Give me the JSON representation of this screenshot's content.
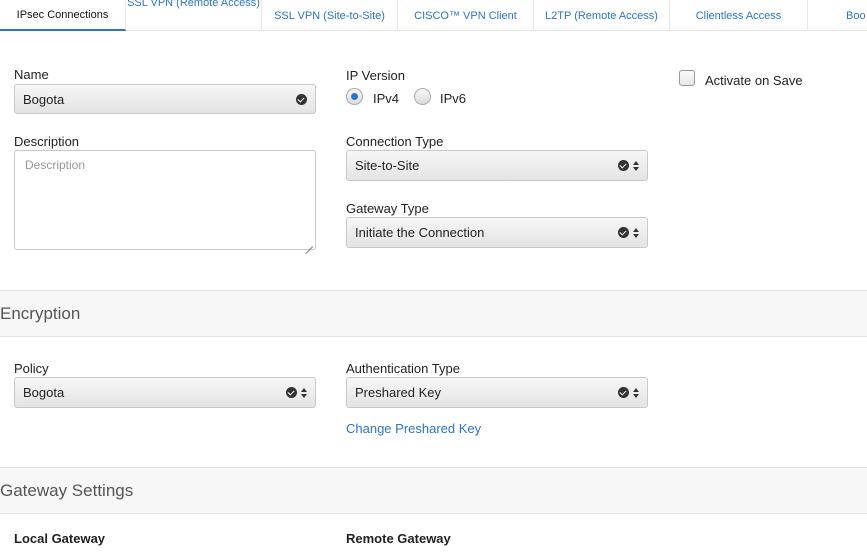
{
  "tabs": [
    {
      "label": "IPsec Connections",
      "active": true
    },
    {
      "label": "SSL VPN (Remote Access)",
      "active": false
    },
    {
      "label": "SSL VPN (Site-to-Site)",
      "active": false
    },
    {
      "label": "CISCO™ VPN Client",
      "active": false
    },
    {
      "label": "L2TP (Remote Access)",
      "active": false
    },
    {
      "label": "Clientless Access",
      "active": false
    },
    {
      "label": "Boo",
      "active": false
    }
  ],
  "general": {
    "name_label": "Name",
    "name_value": "Bogota",
    "description_label": "Description",
    "description_placeholder": "Description",
    "ip_version_label": "IP Version",
    "ipv4_label": "IPv4",
    "ipv6_label": "IPv6",
    "ip_version_selected": "IPv4",
    "activate_label": "Activate on Save",
    "activate_checked": false,
    "connection_type_label": "Connection Type",
    "connection_type_value": "Site-to-Site",
    "gateway_type_label": "Gateway Type",
    "gateway_type_value": "Initiate the Connection"
  },
  "encryption": {
    "section_title": "Encryption",
    "policy_label": "Policy",
    "policy_value": "Bogota",
    "auth_type_label": "Authentication Type",
    "auth_type_value": "Preshared Key",
    "change_key_link": "Change Preshared Key"
  },
  "gateway_settings": {
    "section_title": "Gateway Settings",
    "local_label": "Local Gateway",
    "remote_label": "Remote Gateway"
  },
  "colors": {
    "accent": "#2b76c1",
    "section_bg": "#f7f7f7"
  }
}
